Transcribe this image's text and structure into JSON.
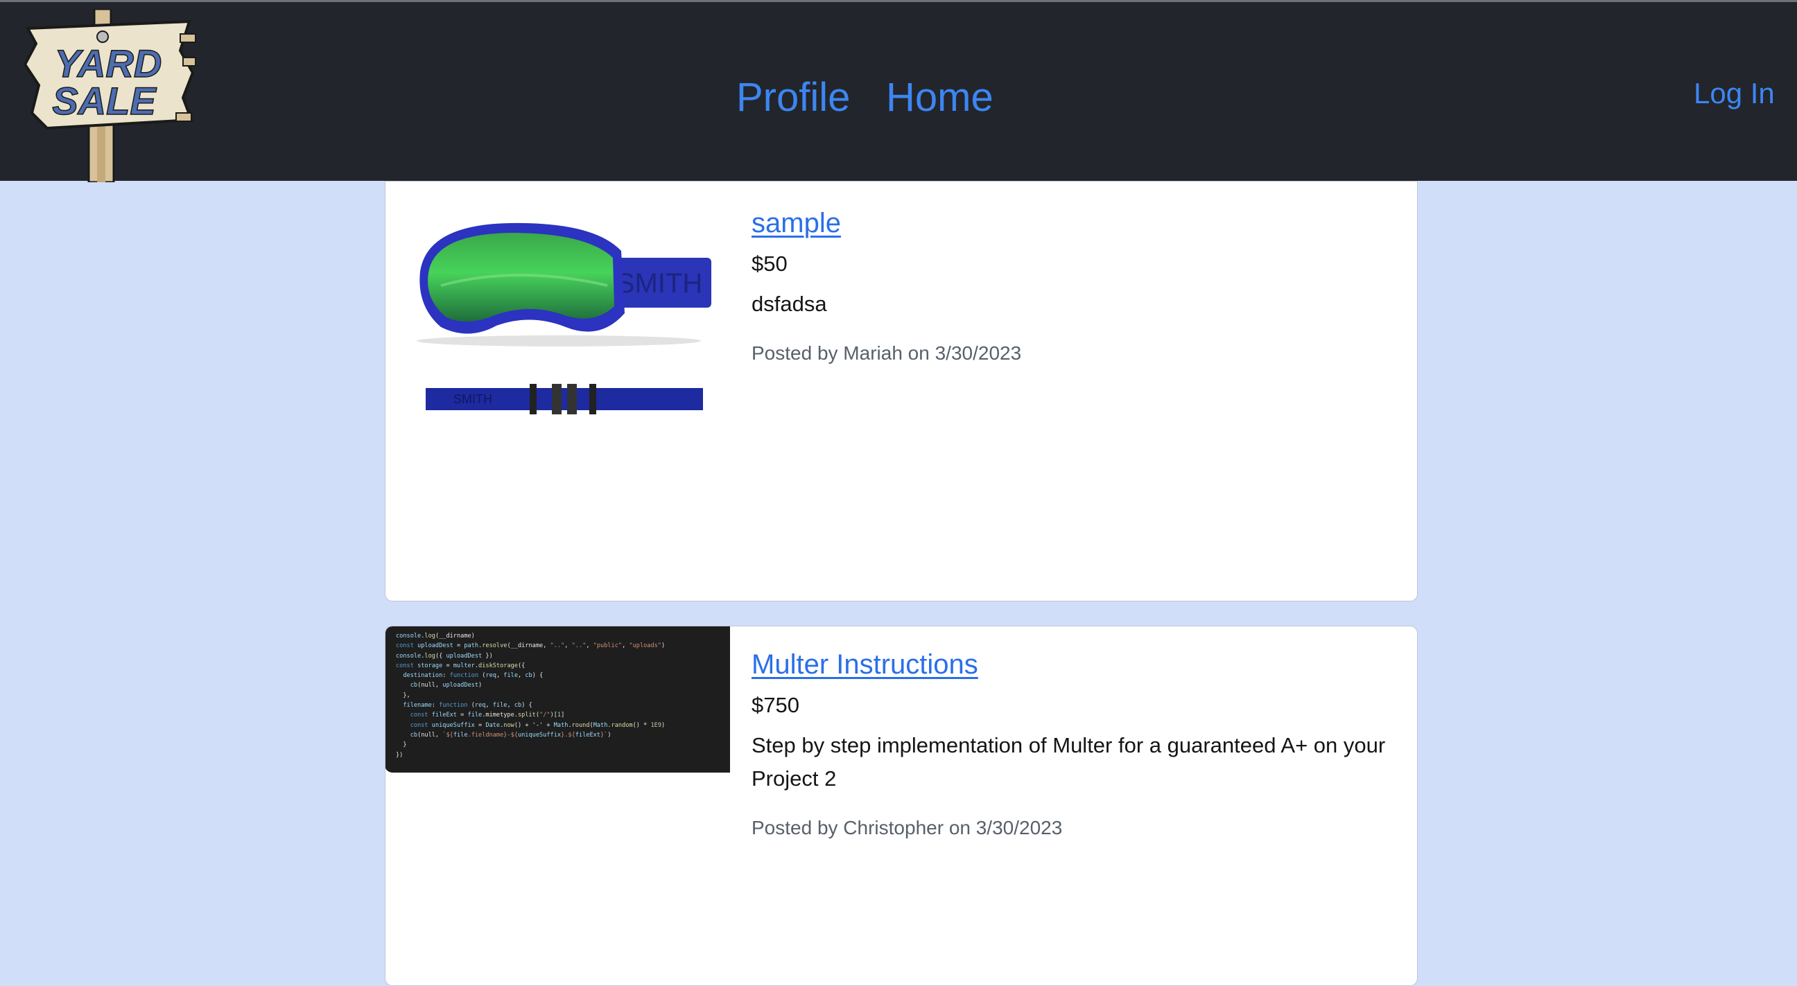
{
  "app": {
    "logo_text": "YARD SALE"
  },
  "nav": {
    "profile": "Profile",
    "home": "Home",
    "login": "Log In"
  },
  "listings": [
    {
      "title": "sample",
      "price": "$50",
      "description": "dsfadsa",
      "posted": "Posted by Mariah on 3/30/2023",
      "image": "ski-goggles-image",
      "image_text": "SMITH"
    },
    {
      "title": "Multer Instructions",
      "price": "$750",
      "description": "Step by step implementation of Multer for a guaranteed A+ on your Project 2",
      "posted": "Posted by Christopher on 3/30/2023",
      "image": "code-screenshot-image",
      "code_lines": [
        "console.log(__dirname)",
        "const uploadDest = path.resolve(__dirname, \"..\", \"..\", \"public\", \"uploads\")",
        "console.log({ uploadDest })",
        "const storage = multer.diskStorage({",
        "  destination: function (req, file, cb) {",
        "    cb(null, uploadDest)",
        "  },",
        "  filename: function (req, file, cb) {",
        "    const fileExt = file.mimetype.split(\"/\")[1]",
        "    const uniqueSuffix = Date.now() + '-' + Math.round(Math.random() * 1E9)",
        "    cb(null, `${file.fieldname}-${uniqueSuffix}.${fileExt}`)",
        "",
        "  }",
        "})"
      ]
    }
  ],
  "colors": {
    "navbar": "#22252b",
    "page_background": "#d0defa",
    "link": "#3d86f2"
  }
}
